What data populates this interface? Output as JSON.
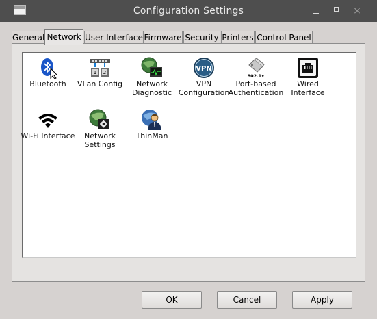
{
  "window": {
    "title": "Configuration Settings",
    "controls": {
      "minimize": "minimize",
      "maximize": "maximize",
      "close": "×"
    }
  },
  "tabs": [
    {
      "label": "General"
    },
    {
      "label": "Network"
    },
    {
      "label": "User Interface"
    },
    {
      "label": "Firmware"
    },
    {
      "label": "Security"
    },
    {
      "label": "Printers"
    },
    {
      "label": "Control Panel"
    }
  ],
  "active_tab": "Network",
  "network_items": [
    {
      "label": "Bluetooth",
      "icon": "bluetooth-icon"
    },
    {
      "label": "VLan Config",
      "icon": "vlan-icon"
    },
    {
      "label": "Network Diagnostic",
      "icon": "network-diagnostic-icon"
    },
    {
      "label": "VPN Configuration",
      "icon": "vpn-icon"
    },
    {
      "label": "Port-based Authentication",
      "icon": "port-auth-icon",
      "icon_text": "802.1x"
    },
    {
      "label": "Wired Interface",
      "icon": "wired-interface-icon"
    },
    {
      "label": "Wi-Fi Interface",
      "icon": "wifi-icon"
    },
    {
      "label": "Network Settings",
      "icon": "network-settings-icon"
    },
    {
      "label": "ThinMan",
      "icon": "thinman-icon"
    }
  ],
  "buttons": {
    "ok": "OK",
    "cancel": "Cancel",
    "apply": "Apply"
  }
}
